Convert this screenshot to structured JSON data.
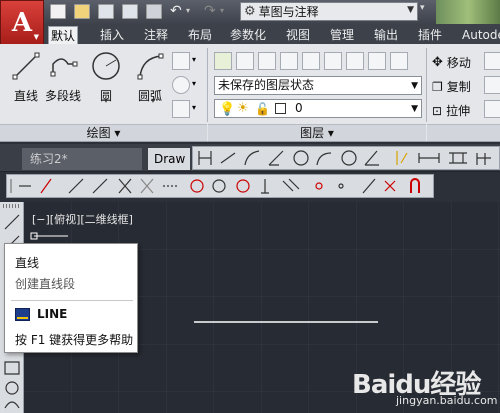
{
  "titlebar": {
    "app_logo": "A",
    "workspace": "草图与注释"
  },
  "ribbon_tabs": [
    {
      "label": "默认",
      "active": true
    },
    {
      "label": "插入"
    },
    {
      "label": "注释"
    },
    {
      "label": "布局"
    },
    {
      "label": "参数化"
    },
    {
      "label": "视图"
    },
    {
      "label": "管理"
    },
    {
      "label": "输出"
    },
    {
      "label": "插件"
    },
    {
      "label": "Autode"
    }
  ],
  "draw_panel": {
    "title": "绘图 ▾",
    "buttons": [
      "直线",
      "多段线",
      "圆",
      "圆弧"
    ]
  },
  "layers_panel": {
    "title": "图层 ▾",
    "layer_state": "未保存的图层状态",
    "current_layer": "0"
  },
  "modify_panel": {
    "items": [
      "移动",
      "复制",
      "拉伸"
    ]
  },
  "doc_tabs": [
    "练习2*",
    "Draw"
  ],
  "viewport_label": "[−][俯视][二维线框]",
  "tooltip": {
    "title": "直线",
    "description": "创建直线段",
    "command": "LINE",
    "help": "按 F1 键获得更多帮助"
  },
  "watermark": {
    "text": "Baidu经验",
    "sub": "jingyan.baidu.com"
  },
  "colors": {
    "canvas": "#272b33",
    "accent_red": "#c8302b",
    "ribbon": "#e4e6ea"
  }
}
